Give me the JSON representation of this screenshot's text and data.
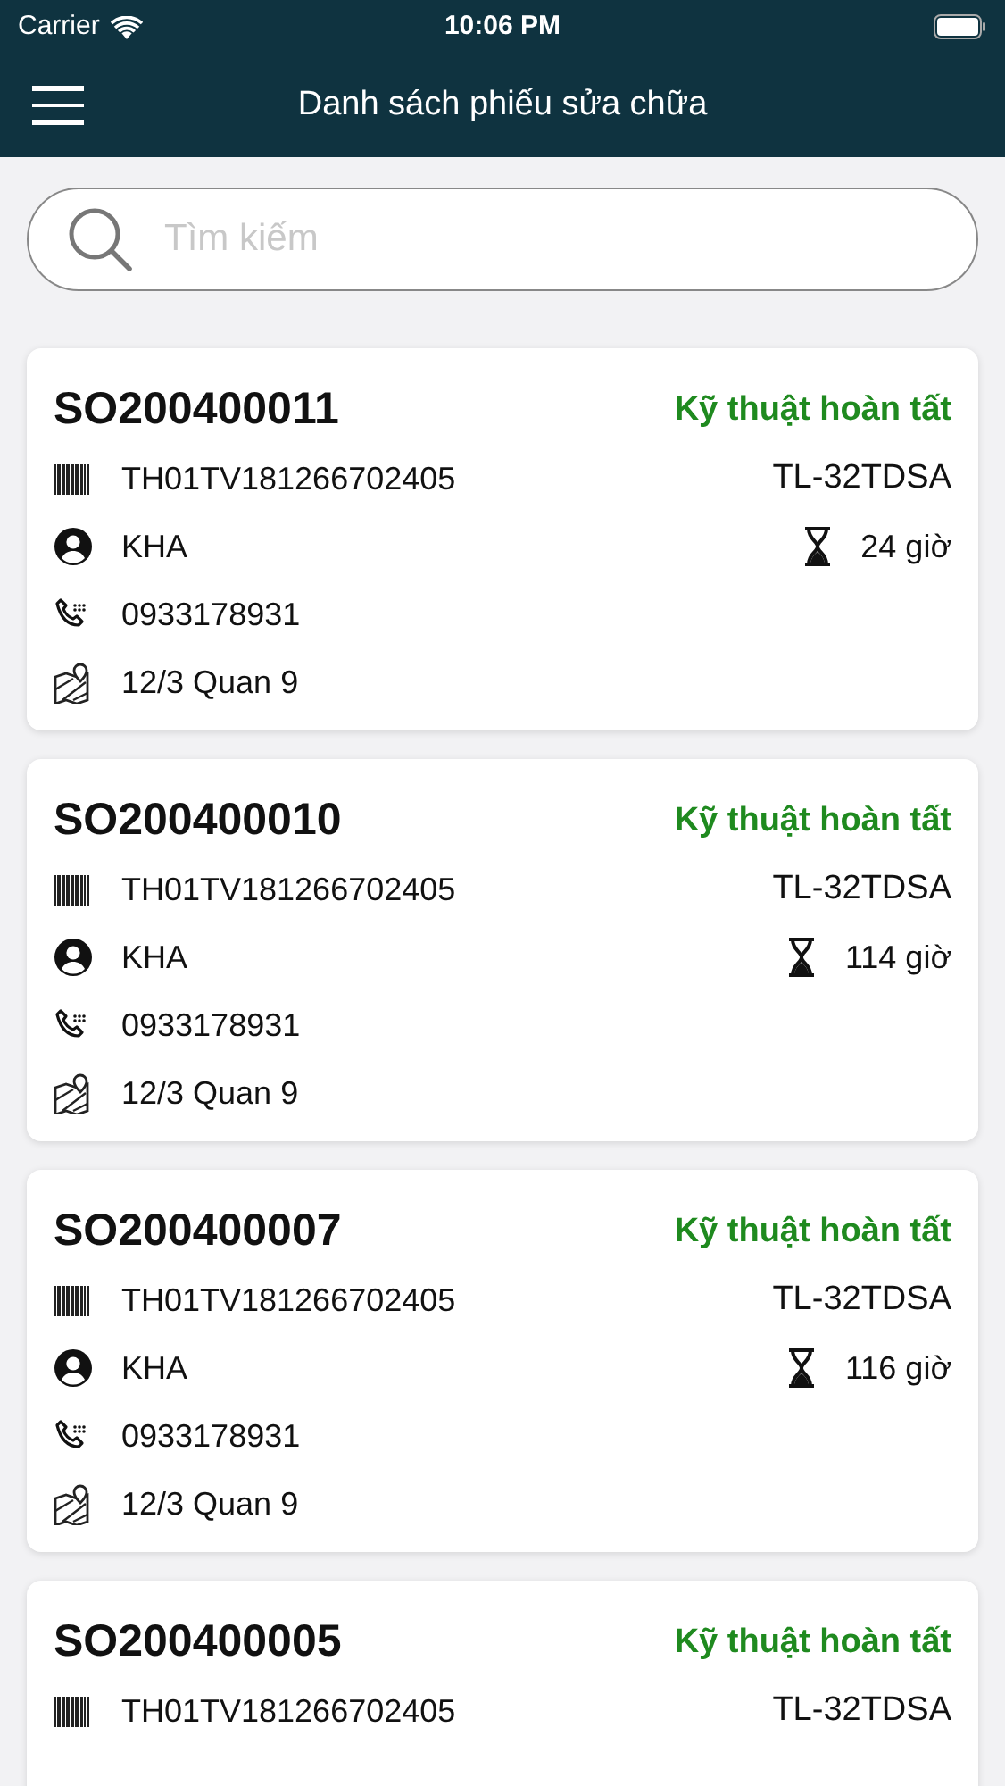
{
  "status_bar": {
    "carrier": "Carrier",
    "time": "10:06 PM"
  },
  "nav": {
    "title": "Danh sách phiếu sửa chữa"
  },
  "search": {
    "placeholder": "Tìm kiếm"
  },
  "orders": [
    {
      "code": "SO200400011",
      "status": "Kỹ thuật hoàn tất",
      "serial": "TH01TV181266702405",
      "model": "TL-32TDSA",
      "customer": "KHA",
      "duration": "24 giờ",
      "phone": "0933178931",
      "address": "12/3 Quan 9"
    },
    {
      "code": "SO200400010",
      "status": "Kỹ thuật hoàn tất",
      "serial": "TH01TV181266702405",
      "model": "TL-32TDSA",
      "customer": "KHA",
      "duration": "114 giờ",
      "phone": "0933178931",
      "address": "12/3 Quan 9"
    },
    {
      "code": "SO200400007",
      "status": "Kỹ thuật hoàn tất",
      "serial": "TH01TV181266702405",
      "model": "TL-32TDSA",
      "customer": "KHA",
      "duration": "116 giờ",
      "phone": "0933178931",
      "address": "12/3 Quan 9"
    },
    {
      "code": "SO200400005",
      "status": "Kỹ thuật hoàn tất",
      "serial": "TH01TV181266702405",
      "model": "TL-32TDSA"
    }
  ]
}
